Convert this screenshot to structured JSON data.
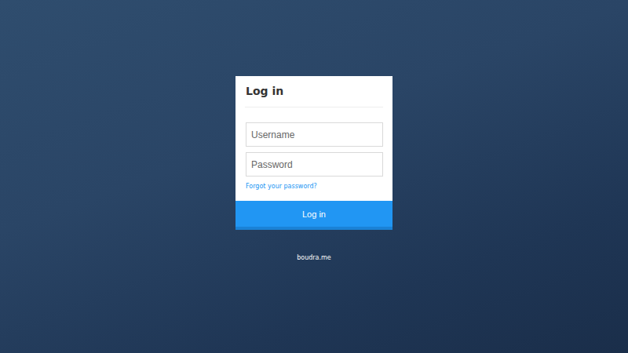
{
  "card": {
    "title": "Log in"
  },
  "fields": [
    {
      "placeholder": "Username"
    },
    {
      "placeholder": "Password"
    }
  ],
  "link": "Forgot your password?",
  "button": "Log in",
  "footer": "boudra.me"
}
